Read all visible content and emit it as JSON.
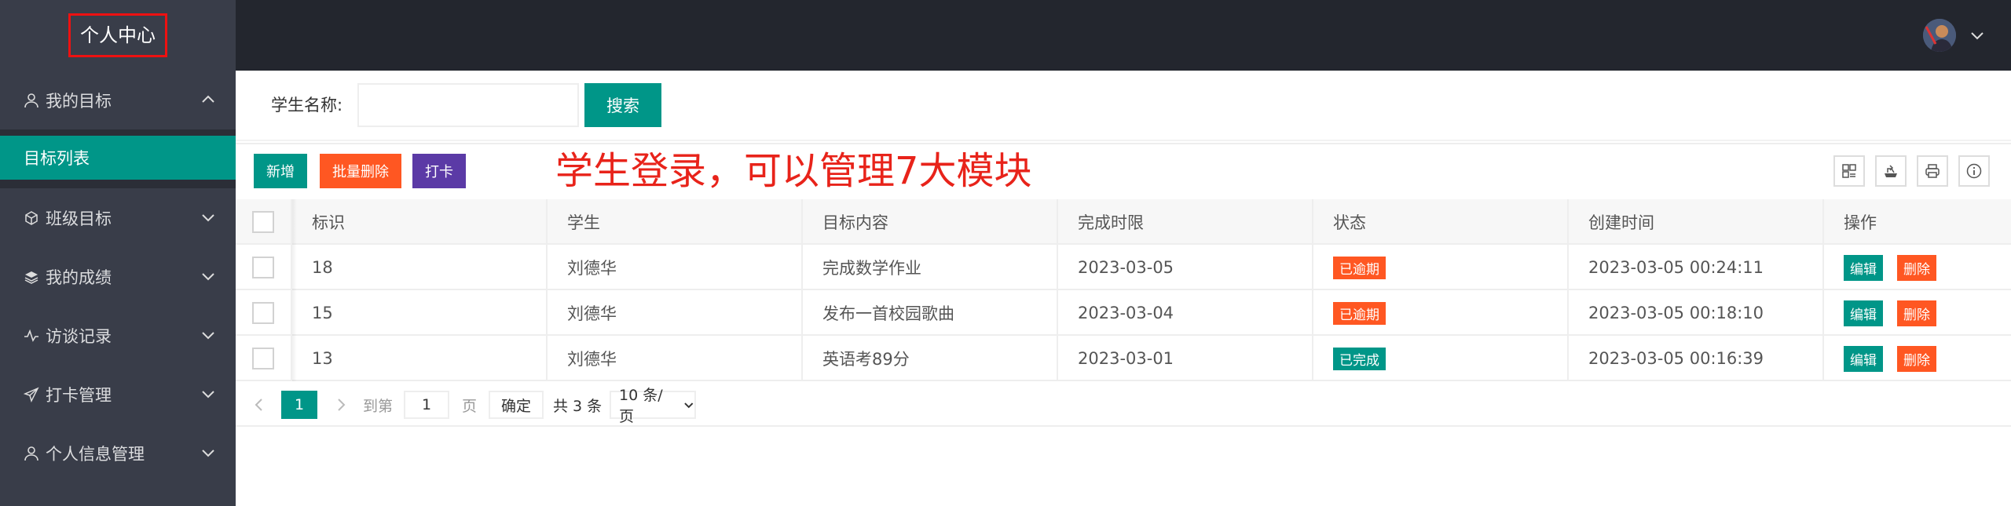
{
  "sidebar": {
    "logo": "个人中心",
    "menu": [
      {
        "label": "我的目标",
        "icon": "user-icon",
        "expanded": true
      },
      {
        "label": "班级目标",
        "icon": "cube-icon",
        "expanded": false
      },
      {
        "label": "我的成绩",
        "icon": "layers-icon",
        "expanded": false
      },
      {
        "label": "访谈记录",
        "icon": "pulse-icon",
        "expanded": false
      },
      {
        "label": "打卡管理",
        "icon": "send-icon",
        "expanded": false
      },
      {
        "label": "个人信息管理",
        "icon": "user-icon",
        "expanded": false
      }
    ],
    "active_submenu": "目标列表"
  },
  "search": {
    "label": "学生名称:",
    "value": "",
    "placeholder": "",
    "button": "搜索"
  },
  "toolbar": {
    "new": "新增",
    "batch_delete": "批量删除",
    "check_in": "打卡",
    "annotation": "学生登录，可以管理7大模块",
    "icons": [
      "columns-icon",
      "export-icon",
      "print-icon",
      "info-icon"
    ]
  },
  "table": {
    "headers": [
      "标识",
      "学生",
      "目标内容",
      "完成时限",
      "状态",
      "创建时间",
      "操作"
    ],
    "rows": [
      {
        "id": "18",
        "student": "刘德华",
        "content": "完成数学作业",
        "deadline": "2023-03-05",
        "status": "已逾期",
        "created": "2023-03-05 00:24:11"
      },
      {
        "id": "15",
        "student": "刘德华",
        "content": "发布一首校园歌曲",
        "deadline": "2023-03-04",
        "status": "已逾期",
        "created": "2023-03-05 00:18:10"
      },
      {
        "id": "13",
        "student": "刘德华",
        "content": "英语考89分",
        "deadline": "2023-03-01",
        "status": "已完成",
        "created": "2023-03-05 00:16:39"
      }
    ],
    "edit_label": "编辑",
    "delete_label": "删除"
  },
  "pagination": {
    "current": "1",
    "goto_label": "到第",
    "goto_value": "1",
    "page_label": "页",
    "confirm": "确定",
    "total": "共 3 条",
    "page_size": "10 条/页"
  },
  "colors": {
    "primary": "#009688",
    "danger": "#ff5722",
    "purple": "#5b3aa6",
    "sidebar": "#393d49",
    "header": "#23262e",
    "annotation": "#e8231a"
  }
}
